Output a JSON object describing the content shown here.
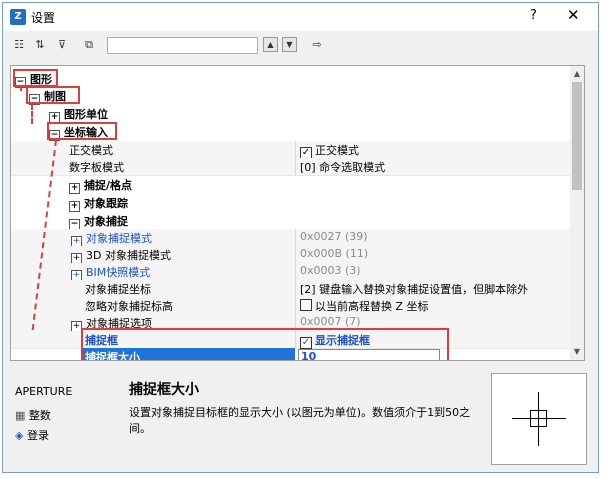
{
  "window": {
    "title": "设置",
    "help": "?",
    "close": "✕",
    "app_icon": "Z"
  },
  "toolbar": {
    "icons": [
      "categorized-view-icon",
      "alphabetical-view-icon",
      "filter-icon",
      "copy-icon"
    ],
    "search_value": "",
    "up_glyph": "▲",
    "down_glyph": "▼",
    "export_glyph": "⇨"
  },
  "tree": {
    "graphics": "图形",
    "drafting": "制图",
    "drawing_units": "图形单位",
    "coord_input": "坐标输入",
    "ortho_name": "正交模式",
    "ortho_value": "正交模式",
    "tablet_name": "数字板模式",
    "tablet_value": "[0] 命令选取模式",
    "snap_grid": "捕捉/格点",
    "object_tracking": "对象跟踪",
    "object_snap": "对象捕捉",
    "osnap_mode_name": "对象捕捉模式",
    "osnap_mode_value": "0x0027 (39)",
    "osnap3d_name": "3D 对象捕捉模式",
    "osnap3d_value": "0x000B (11)",
    "bim_name": "BIM快照模式",
    "bim_value": "0x0003 (3)",
    "osnap_coords_name": "对象捕捉坐标",
    "osnap_coords_value": "[2] 键盘输入替换对象捕捉设置值，但脚本除外",
    "ignore_z_name": "忽略对象捕捉标高",
    "ignore_z_value": "以当前高程替换 Z 坐标",
    "osnap_options_name": "对象捕捉选项",
    "osnap_options_value": "0x0007 (7)",
    "aperture_name": "捕捉框",
    "aperture_value": "显示捕捉框",
    "aperture_size_name": "捕捉框大小",
    "aperture_size_value": "10"
  },
  "bottom": {
    "command": "APERTURE",
    "link1": "整数",
    "link2": "登录",
    "desc_title": "捕捉框大小",
    "desc_text": "设置对象捕捉目标框的显示大小 (以图元为单位)。数值须介于1到50之间。"
  }
}
